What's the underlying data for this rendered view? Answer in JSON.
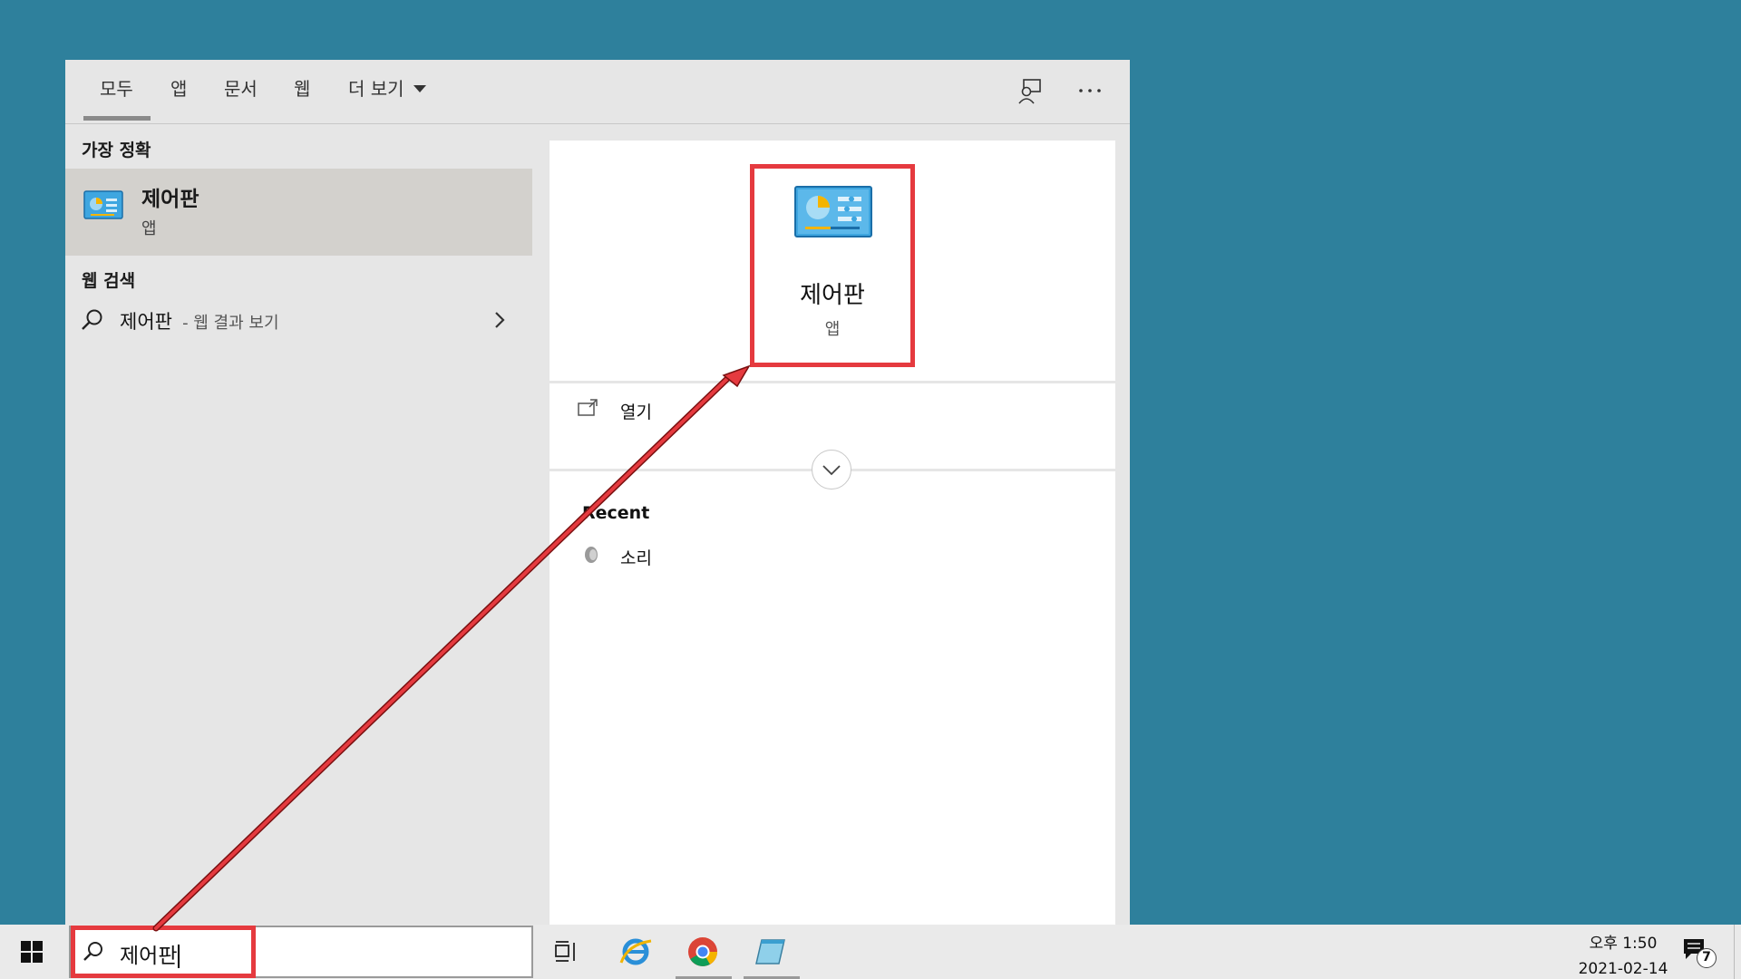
{
  "tabs": {
    "items": [
      {
        "label": "모두"
      },
      {
        "label": "앱"
      },
      {
        "label": "문서"
      },
      {
        "label": "웹"
      },
      {
        "label": "더 보기"
      }
    ]
  },
  "left": {
    "best_match_header": "가장 정확",
    "best_match": {
      "title": "제어판",
      "subtitle": "앱"
    },
    "web_header": "웹 검색",
    "web_item": {
      "query": "제어판",
      "suffix": "- 웹 결과 보기"
    }
  },
  "right": {
    "app_title": "제어판",
    "app_subtitle": "앱",
    "open_label": "열기",
    "recent_header": "Recent",
    "recent_items": [
      {
        "label": "소리"
      }
    ]
  },
  "taskbar": {
    "search_value": "제어판",
    "time": "오후 1:50",
    "date": "2021-02-14",
    "notification_count": "7"
  },
  "colors": {
    "desktop": "#2e809c",
    "highlight": "#e53a3f"
  }
}
